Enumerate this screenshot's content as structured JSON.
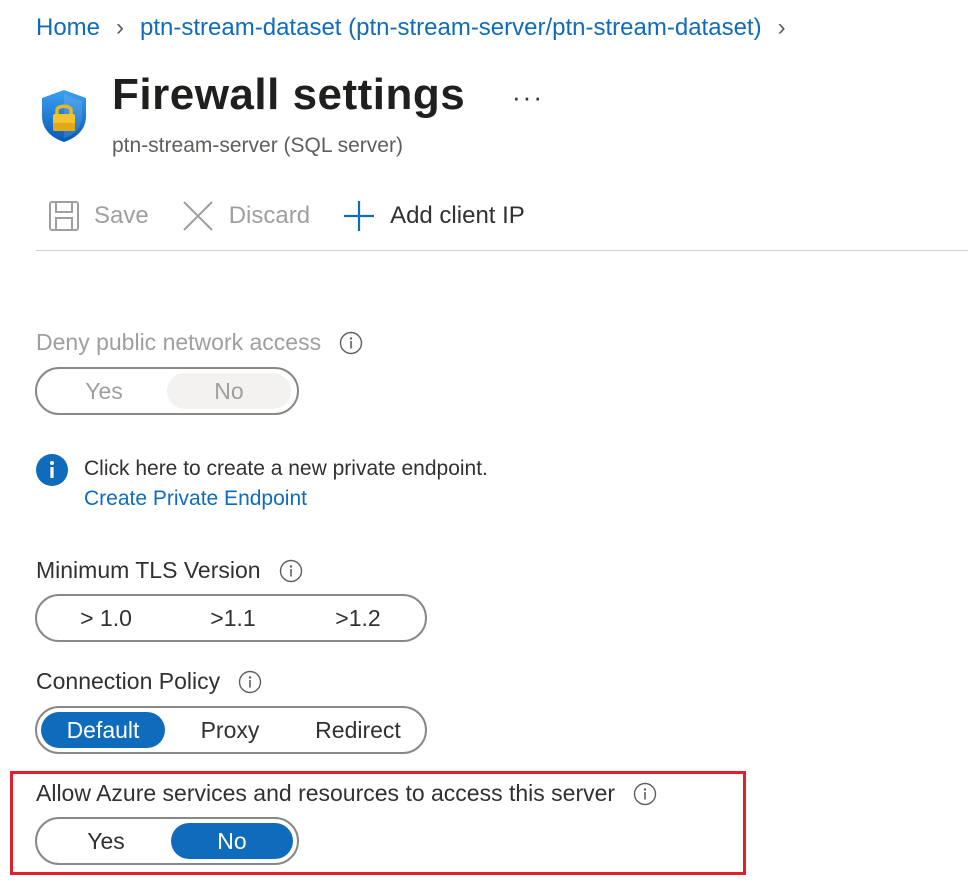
{
  "breadcrumb": {
    "home": "Home",
    "dataset": "ptn-stream-dataset (ptn-stream-server/ptn-stream-dataset)"
  },
  "header": {
    "title": "Firewall settings",
    "subtitle": "ptn-stream-server (SQL server)",
    "more": "···",
    "icon": "shield-lock-icon"
  },
  "toolbar": {
    "save_label": "Save",
    "discard_label": "Discard",
    "add_client_ip_label": "Add client IP"
  },
  "deny_public": {
    "label": "Deny public network access",
    "options": [
      "Yes",
      "No"
    ],
    "selected": "No",
    "disabled": true
  },
  "private_endpoint": {
    "message": "Click here to create a new private endpoint.",
    "link": "Create Private Endpoint"
  },
  "tls": {
    "label": "Minimum TLS Version",
    "options": [
      "> 1.0",
      ">1.1",
      ">1.2"
    ]
  },
  "connection_policy": {
    "label": "Connection Policy",
    "options": [
      "Default",
      "Proxy",
      "Redirect"
    ],
    "selected": "Default"
  },
  "allow_azure": {
    "label": "Allow Azure services and resources to access this server",
    "options": [
      "Yes",
      "No"
    ],
    "selected": "No"
  },
  "colors": {
    "accent": "#0f6cbd",
    "highlight_box": "#e0202a",
    "disabled_text": "#a19f9d"
  }
}
